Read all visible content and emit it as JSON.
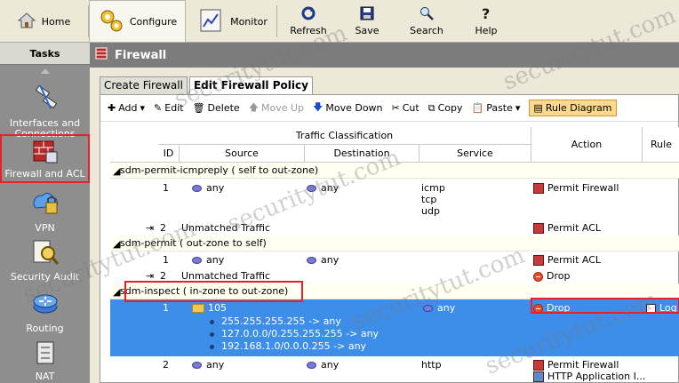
{
  "toolbar": {
    "home": "Home",
    "configure": "Configure",
    "monitor": "Monitor",
    "refresh": "Refresh",
    "save": "Save",
    "search": "Search",
    "help": "Help"
  },
  "tasks": {
    "title": "Tasks",
    "items": [
      {
        "label": "Interfaces and Connections"
      },
      {
        "label": "Firewall and ACL"
      },
      {
        "label": "VPN"
      },
      {
        "label": "Security Audit"
      },
      {
        "label": "Routing"
      },
      {
        "label": "NAT"
      }
    ]
  },
  "main": {
    "title": "Firewall",
    "tabs": [
      "Create Firewall",
      "Edit Firewall Policy"
    ],
    "actions": {
      "add": "Add",
      "edit": "Edit",
      "delete": "Delete",
      "move_up": "Move Up",
      "move_down": "Move Down",
      "cut": "Cut",
      "copy": "Copy",
      "paste": "Paste",
      "rule_diagram": "Rule Diagram"
    }
  },
  "grid": {
    "header_group": "Traffic Classification",
    "columns": {
      "id": "ID",
      "source": "Source",
      "destination": "Destination",
      "service": "Service",
      "action": "Action",
      "rule": "Rule"
    },
    "groups": [
      {
        "name": "sdm-permit-icmpreply ( self to out-zone)",
        "rows": [
          {
            "id": "1",
            "source": "any",
            "destination": "any",
            "service": [
              "icmp",
              "tcp",
              "udp"
            ],
            "action": "Permit Firewall"
          },
          {
            "id": "2",
            "source": "Unmatched Traffic",
            "action": "Permit ACL"
          }
        ]
      },
      {
        "name": "sdm-permit ( out-zone to self)",
        "rows": [
          {
            "id": "1",
            "source": "any",
            "destination": "any",
            "action": "Permit ACL"
          },
          {
            "id": "2",
            "source": "Unmatched Traffic",
            "action": "Drop"
          }
        ]
      },
      {
        "name": "sdm-inspect ( in-zone to out-zone)",
        "rows": [
          {
            "id": "1",
            "source": "105",
            "destination": "",
            "service": "any",
            "action": "Drop",
            "rule": "Log",
            "subnets": [
              "255.255.255.255 -> any",
              "127.0.0.0/0.255.255.255 -> any",
              "192.168.1.0/0.0.0.255 -> any"
            ]
          },
          {
            "id": "2",
            "source": "any",
            "destination": "any",
            "service": "http",
            "action": "Permit Firewall",
            "action2": "HTTP Application I..."
          }
        ]
      }
    ]
  },
  "watermark": "securitytut.com"
}
